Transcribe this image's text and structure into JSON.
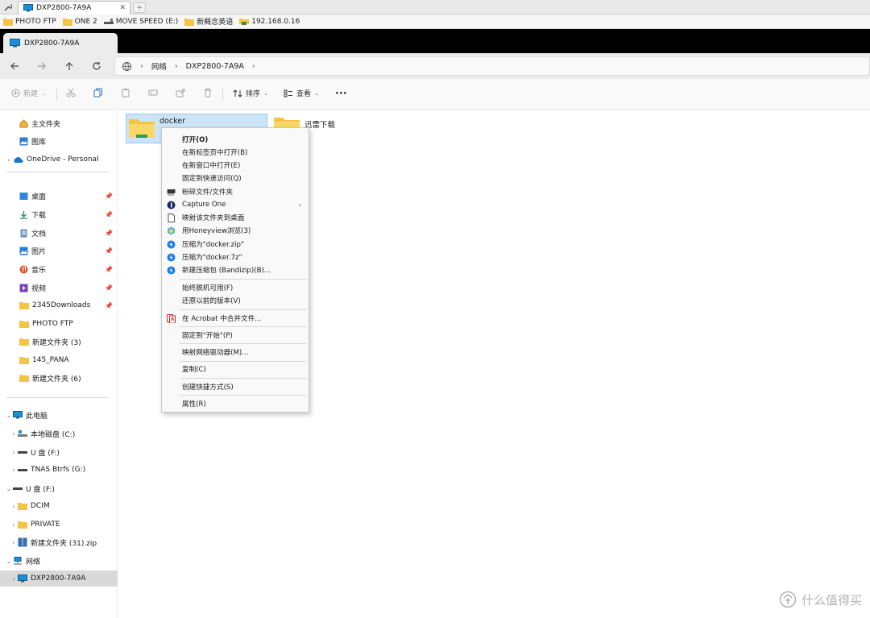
{
  "host": {
    "tab_title": "DXP2800-7A9A",
    "new_tab_symbol": "+"
  },
  "bookmarks": [
    {
      "label": "PHOTO FTP",
      "icon": "folder-icon"
    },
    {
      "label": "ONE 2",
      "icon": "folder-icon"
    },
    {
      "label": "MOVE SPEED (E:)",
      "icon": "drive-icon"
    },
    {
      "label": "新概念英语",
      "icon": "folder-icon"
    },
    {
      "label": "192.168.0.16",
      "icon": "network-share-icon"
    }
  ],
  "explorer": {
    "tab_title": "DXP2800-7A9A",
    "breadcrumb": [
      "网络",
      "DXP2800-7A9A"
    ],
    "toolbar": {
      "new_label": "新建",
      "sort_label": "排序",
      "view_label": "查看",
      "more_label": "···"
    },
    "sidebar": {
      "quick": [
        {
          "label": "主文件夹",
          "icon": "home-icon"
        },
        {
          "label": "图库",
          "icon": "gallery-icon"
        },
        {
          "label": "OneDrive - Personal",
          "icon": "onedrive-icon"
        }
      ],
      "pinned": [
        {
          "label": "桌面",
          "icon": "desktop-icon"
        },
        {
          "label": "下载",
          "icon": "download-icon"
        },
        {
          "label": "文档",
          "icon": "document-icon"
        },
        {
          "label": "图片",
          "icon": "picture-icon"
        },
        {
          "label": "音乐",
          "icon": "music-icon"
        },
        {
          "label": "视频",
          "icon": "video-icon"
        },
        {
          "label": "2345Downloads",
          "icon": "folder-icon"
        },
        {
          "label": "PHOTO FTP",
          "icon": "folder-icon"
        },
        {
          "label": "新建文件夹 (3)",
          "icon": "folder-icon"
        },
        {
          "label": "145_PANA",
          "icon": "folder-icon"
        },
        {
          "label": "新建文件夹 (6)",
          "icon": "folder-icon"
        }
      ],
      "tree": [
        {
          "label": "此电脑",
          "icon": "pc-icon"
        },
        {
          "label": "本地磁盘 (C:)",
          "icon": "drive-icon"
        },
        {
          "label": "U 盘 (F:)",
          "icon": "usb-icon"
        },
        {
          "label": "TNAS Btrfs  (G:)",
          "icon": "usb-icon"
        },
        {
          "label": "U 盘 (F:)",
          "icon": "usb-icon"
        },
        {
          "label": "DCIM",
          "icon": "folder-icon"
        },
        {
          "label": "PRIVATE",
          "icon": "folder-icon"
        },
        {
          "label": "新建文件夹 (31).zip",
          "icon": "zip-icon"
        },
        {
          "label": "网络",
          "icon": "network-icon"
        },
        {
          "label": "DXP2800-7A9A",
          "icon": "pc-icon"
        }
      ]
    },
    "files": [
      {
        "name": "docker",
        "icon": "folder-icon"
      },
      {
        "name": "迅雷下载",
        "icon": "folder-icon"
      }
    ],
    "context_menu": {
      "items": [
        {
          "label": "打开(O)"
        },
        {
          "label": "在新标签页中打开(B)"
        },
        {
          "label": "在新窗口中打开(E)"
        },
        {
          "label": "固定到快速访问(Q)"
        },
        {
          "label": "粉碎文件/文件夹",
          "icon": "shredder-icon"
        },
        {
          "label": "Capture One",
          "icon": "capture-one-icon"
        },
        {
          "label": "映射该文件夹到桌面",
          "icon": "file-icon"
        },
        {
          "label": "用Honeyview浏览(3)",
          "icon": "honeyview-icon"
        },
        {
          "label": "压缩为\"docker.zip\"",
          "icon": "bandizip-icon"
        },
        {
          "label": "压缩为\"docker.7z\"",
          "icon": "bandizip-icon"
        },
        {
          "label": "新建压缩包 (Bandizip)(B)...",
          "icon": "bandizip-icon"
        },
        {
          "label": "始终脱机可用(F)"
        },
        {
          "label": "还原以前的版本(V)"
        },
        {
          "label": "在 Acrobat 中合并文件...",
          "icon": "acrobat-icon"
        },
        {
          "label": "固定到\"开始\"(P)"
        },
        {
          "label": "映射网络驱动器(M)..."
        },
        {
          "label": "复制(C)"
        },
        {
          "label": "创建快捷方式(S)"
        },
        {
          "label": "属性(R)"
        }
      ]
    }
  },
  "watermark": "什么值得买",
  "colors": {
    "accent": "#0067c0",
    "folder": "#f4c542",
    "selection": "#cce4f7"
  }
}
